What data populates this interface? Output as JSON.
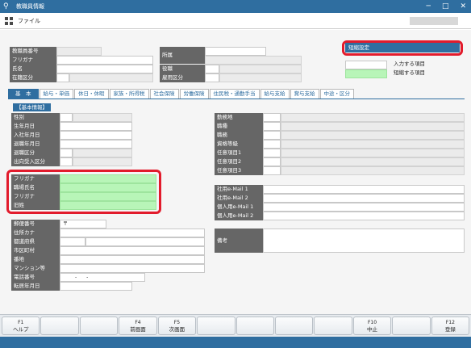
{
  "window": {
    "title": "教職員情報",
    "title_icon": "search-plus-icon",
    "controls": [
      "─",
      "□",
      "✕"
    ]
  },
  "menu": {
    "file": "ファイル"
  },
  "header": {
    "left_labels": [
      "教職員番号",
      "フリガナ",
      "氏名",
      "在籍区分"
    ],
    "mid_labels": [
      "所属",
      "役職",
      "雇用区分"
    ]
  },
  "shortcut": {
    "label": "短縮設定"
  },
  "legend": {
    "input": "入力する項目",
    "short": "短縮する項目"
  },
  "tabs": [
    "基　本",
    "給与・単価",
    "休日・休暇",
    "家族・所得税",
    "社会保険",
    "労働保険",
    "住民税・通勤手当",
    "給与支給",
    "賞与支給",
    "中途・区分"
  ],
  "basic": {
    "heading": "【基本情報】",
    "left_labels": [
      "性別",
      "生年月日",
      "入社年月日",
      "退職年月日",
      "退職区分",
      "出向受入区分"
    ],
    "right_labels": [
      "勤務地",
      "職種",
      "職務",
      "資格等級",
      "任意項目1",
      "任意項目2",
      "任意項目3"
    ]
  },
  "kana": {
    "labels": [
      "フリガナ",
      "職場氏名",
      "フリガナ",
      "旧姓"
    ]
  },
  "email": {
    "labels": [
      "社用e-Mail 1",
      "社用e-Mail 2",
      "個人用e-Mail 1",
      "個人用e-Mail 2"
    ]
  },
  "address": {
    "labels": [
      "郵便番号",
      "住所カナ",
      "都道府県",
      "市区町村",
      "番地",
      "マンション等",
      "電話番号",
      "転居年月日"
    ],
    "postal_mark": "〒",
    "phone_sep": "-　　-"
  },
  "remarks": {
    "label": "備考"
  },
  "fkeys": [
    {
      "key": "F1",
      "label": "ヘルプ"
    },
    {
      "key": "",
      "label": ""
    },
    {
      "key": "",
      "label": ""
    },
    {
      "key": "F4",
      "label": "前画面"
    },
    {
      "key": "F5",
      "label": "次画面"
    },
    {
      "key": "",
      "label": ""
    },
    {
      "key": "",
      "label": ""
    },
    {
      "key": "",
      "label": ""
    },
    {
      "key": "",
      "label": ""
    },
    {
      "key": "F10",
      "label": "中止"
    },
    {
      "key": "",
      "label": ""
    },
    {
      "key": "F12",
      "label": "登録"
    }
  ],
  "colors": {
    "accent": "#2f6ea0",
    "label_bg": "#666666",
    "highlight": "#e21b2c",
    "short_field": "#b8f5b8"
  }
}
